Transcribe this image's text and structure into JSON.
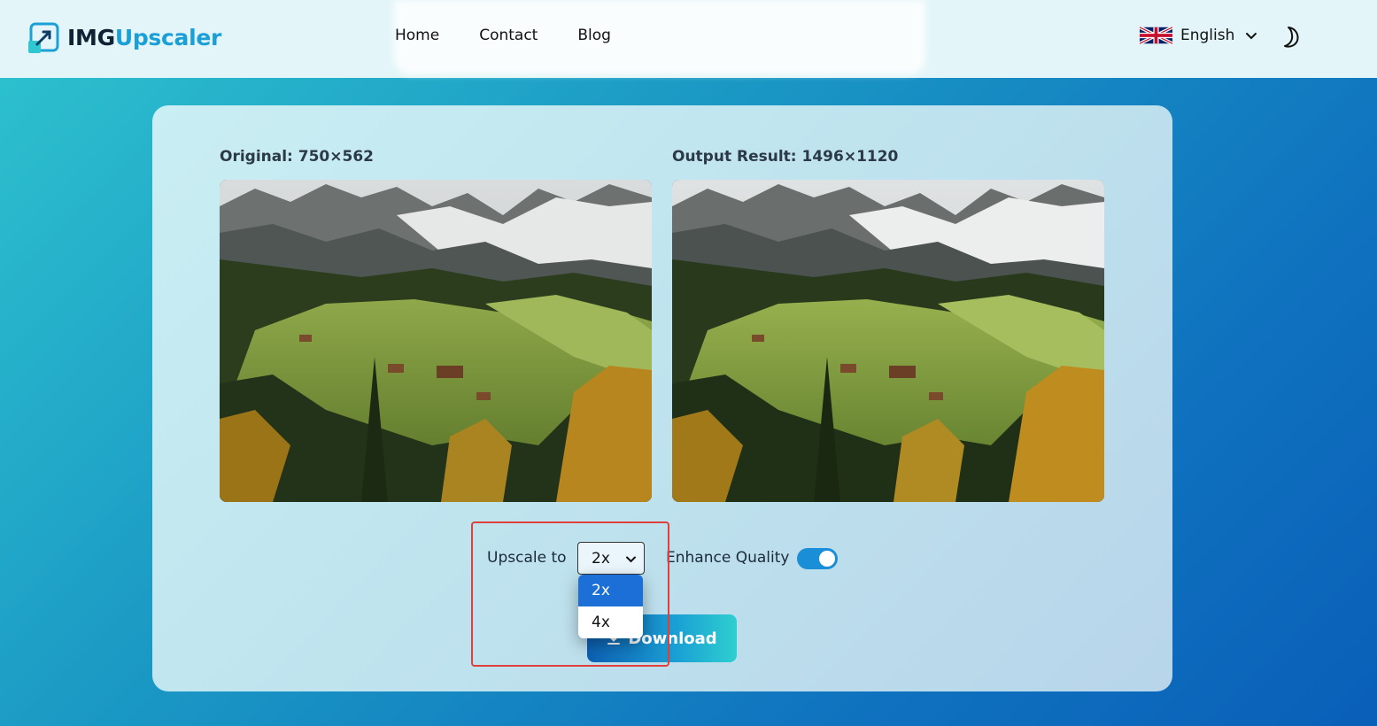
{
  "header": {
    "logo": {
      "part1": "IMG",
      "part2": "Upscaler",
      "icon": "upscale-logo-icon"
    },
    "nav": [
      {
        "label": "Home"
      },
      {
        "label": "Contact"
      },
      {
        "label": "Blog"
      }
    ],
    "language": {
      "label": "English",
      "flag": "uk-flag-icon"
    },
    "theme_toggle_icon": "moon-icon"
  },
  "main": {
    "original_label": "Original: 750×562",
    "output_label": "Output Result: 1496×1120",
    "upscale_label": "Upscale to",
    "upscale_value": "2x",
    "upscale_options": [
      "2x",
      "4x"
    ],
    "enhance_label": "Enhance Quality",
    "enhance_on": true,
    "download_label": "Download"
  },
  "colors": {
    "accent": "#1a8fd8",
    "brand_blue": "#1a9fd6",
    "highlight": "#e0403c",
    "selected_option": "#1b6fd6"
  }
}
